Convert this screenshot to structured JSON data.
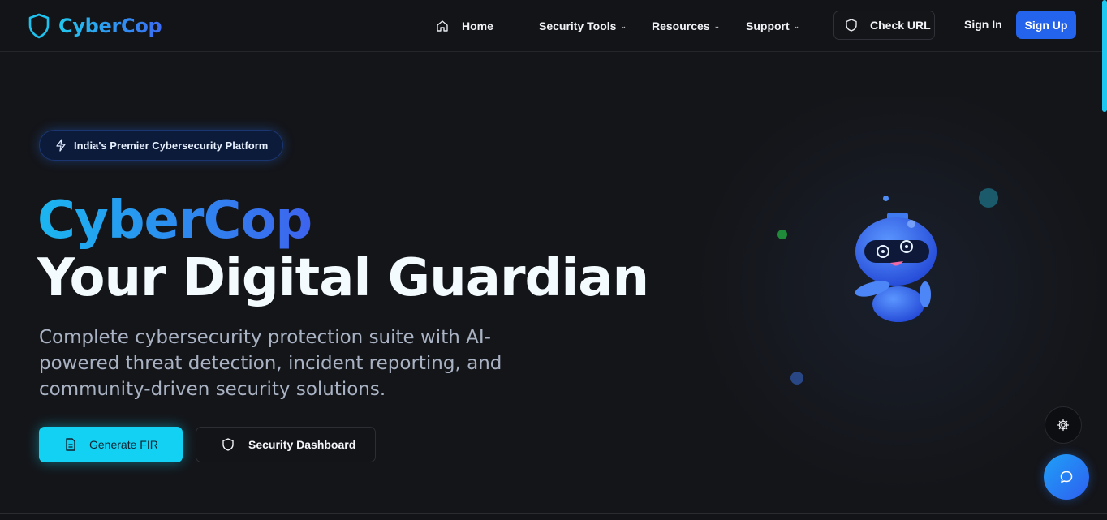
{
  "brand": {
    "name": "CyberCop",
    "icon": "shield-icon",
    "accent": "#22c7ee"
  },
  "nav": {
    "home": "Home",
    "security_tools": "Security Tools",
    "resources": "Resources",
    "support": "Support",
    "check_url": "Check URL",
    "sign_in": "Sign In",
    "sign_up": "Sign Up"
  },
  "hero": {
    "badge": "India's Premier Cybersecurity Platform",
    "title": "CyberCop",
    "subtitle": "Your Digital Guardian",
    "description": "Complete cybersecurity protection suite with AI-powered threat detection, incident reporting, and community-driven security solutions.",
    "primary_button": "Generate FIR",
    "secondary_button": "Security Dashboard"
  },
  "colors": {
    "background": "#141519",
    "primary_button": "#12d1f2",
    "sign_up": "#2463eb",
    "title_gradient_start": "#1bb6f0",
    "title_gradient_end": "#3d63ee"
  },
  "icons": {
    "home": "home-icon",
    "check_url": "shield-icon",
    "badge": "lightning-icon",
    "generate_fir": "document-icon",
    "dashboard": "shield-icon",
    "settings": "gear-icon",
    "chat": "chat-bubble-icon",
    "mascot": "robot-mascot"
  }
}
